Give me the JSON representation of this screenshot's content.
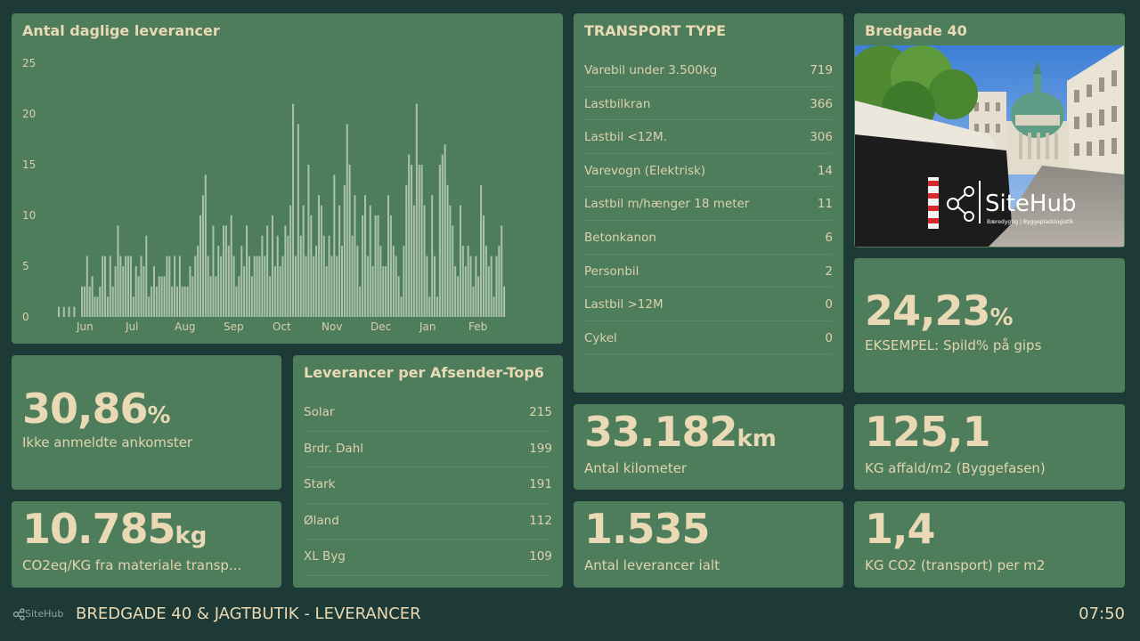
{
  "chart_data": {
    "type": "bar",
    "title": "Antal daglige leverancer",
    "y_ticks": [
      "25",
      "20",
      "15",
      "10",
      "5",
      "0"
    ],
    "ylim": [
      0,
      25
    ],
    "x_tick_labels": [
      "Jun",
      "Jul",
      "Aug",
      "Sep",
      "Oct",
      "Nov",
      "Dec",
      "Jan",
      "Feb"
    ],
    "values": [
      1,
      0,
      1,
      0,
      1,
      0,
      1,
      0,
      0,
      3,
      3,
      6,
      3,
      4,
      2,
      2,
      3,
      6,
      6,
      2,
      6,
      3,
      5,
      9,
      6,
      5,
      6,
      6,
      6,
      2,
      5,
      4,
      6,
      5,
      8,
      2,
      3,
      5,
      3,
      4,
      4,
      4,
      6,
      6,
      3,
      6,
      3,
      6,
      3,
      3,
      3,
      5,
      4,
      6,
      7,
      10,
      12,
      14,
      6,
      4,
      9,
      4,
      7,
      6,
      9,
      9,
      7,
      10,
      6,
      3,
      4,
      7,
      5,
      9,
      6,
      4,
      6,
      6,
      6,
      8,
      6,
      9,
      4,
      10,
      5,
      8,
      5,
      6,
      9,
      8,
      11,
      21,
      6,
      19,
      8,
      11,
      6,
      15,
      10,
      6,
      7,
      12,
      11,
      8,
      5,
      8,
      6,
      14,
      6,
      11,
      7,
      13,
      19,
      15,
      8,
      12,
      7,
      3,
      10,
      12,
      6,
      11,
      5,
      10,
      10,
      7,
      5,
      5,
      12,
      10,
      7,
      6,
      4,
      2,
      7,
      13,
      16,
      15,
      11,
      21,
      15,
      15,
      11,
      6,
      2,
      12,
      6,
      2,
      15,
      16,
      17,
      13,
      11,
      9,
      5,
      4,
      11,
      7,
      5,
      7,
      6,
      3,
      6,
      4,
      13,
      10,
      7,
      5,
      6,
      2,
      6,
      7,
      9,
      3
    ]
  },
  "transport": {
    "title": "TRANSPORT TYPE",
    "items": [
      {
        "label": "Varebil under 3.500kg",
        "value": "719"
      },
      {
        "label": "Lastbilkran",
        "value": "366"
      },
      {
        "label": "Lastbil <12M.",
        "value": "306"
      },
      {
        "label": "Varevogn (Elektrisk)",
        "value": "14"
      },
      {
        "label": "Lastbil m/hænger 18 meter",
        "value": "11"
      },
      {
        "label": "Betonkanon",
        "value": "6"
      },
      {
        "label": "Personbil",
        "value": "2"
      },
      {
        "label": "Lastbil >12M",
        "value": "0"
      },
      {
        "label": "Cykel",
        "value": "0"
      }
    ]
  },
  "photo": {
    "title": "Bredgade 40",
    "logo_text": "SiteHub",
    "logo_tagline": "Bæredygtig | Byggepladslogistik"
  },
  "spild": {
    "value": "24,23",
    "unit": "%",
    "label": "EKSEMPEL: Spild% på gips"
  },
  "ikke_anmeldte": {
    "value": "30,86",
    "unit": "%",
    "label": "Ikke anmeldte ankomster"
  },
  "afsender": {
    "title": "Leverancer per Afsender-Top6",
    "items": [
      {
        "label": "Solar",
        "value": "215"
      },
      {
        "label": "Brdr. Dahl",
        "value": "199"
      },
      {
        "label": "Stark",
        "value": "191"
      },
      {
        "label": "Øland",
        "value": "112"
      },
      {
        "label": "XL Byg",
        "value": "109"
      }
    ]
  },
  "kilometer": {
    "value": "33.182",
    "unit": "km",
    "label": "Antal kilometer"
  },
  "affald": {
    "value": "125,1",
    "unit": "",
    "label": "KG affald/m2 (Byggefasen)"
  },
  "co2": {
    "value": "10.785",
    "unit": "kg",
    "label": "CO2eq/KG fra materiale transp..."
  },
  "leverancer": {
    "value": "1.535",
    "unit": "",
    "label": "Antal leverancer ialt"
  },
  "co2_transport": {
    "value": "1,4",
    "unit": "",
    "label": "KG CO2 (transport) per m2"
  },
  "footer": {
    "logo": "SiteHub",
    "title": "BREDGADE 40 & JAGTBUTIK - LEVERANCER",
    "time": "07:50"
  },
  "colors": {
    "background": "#1e3a36",
    "card": "#4e7d5c",
    "text": "#e9d9b4",
    "bars": "#a9c2a8"
  }
}
